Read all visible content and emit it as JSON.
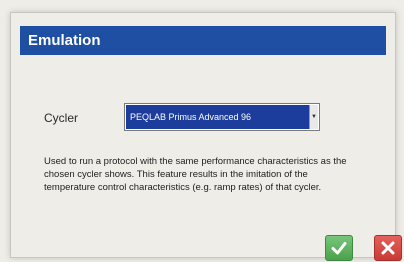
{
  "dialog": {
    "title": "Emulation",
    "cycler_label": "Cycler",
    "cycler_selected": "PEQLAB Primus Advanced 96",
    "description": "Used to run a protocol with the same performance characteristics as the chosen cycler shows. This feature results in the imitation of the temperature control characteristics (e.g. ramp rates) of that cycler.",
    "ok_icon": "check-icon",
    "cancel_icon": "close-icon"
  },
  "colors": {
    "title_bar": "#1f4fa3",
    "selection": "#1c3d9c",
    "ok_button": "#4aa24c",
    "cancel_button": "#c73b36"
  }
}
